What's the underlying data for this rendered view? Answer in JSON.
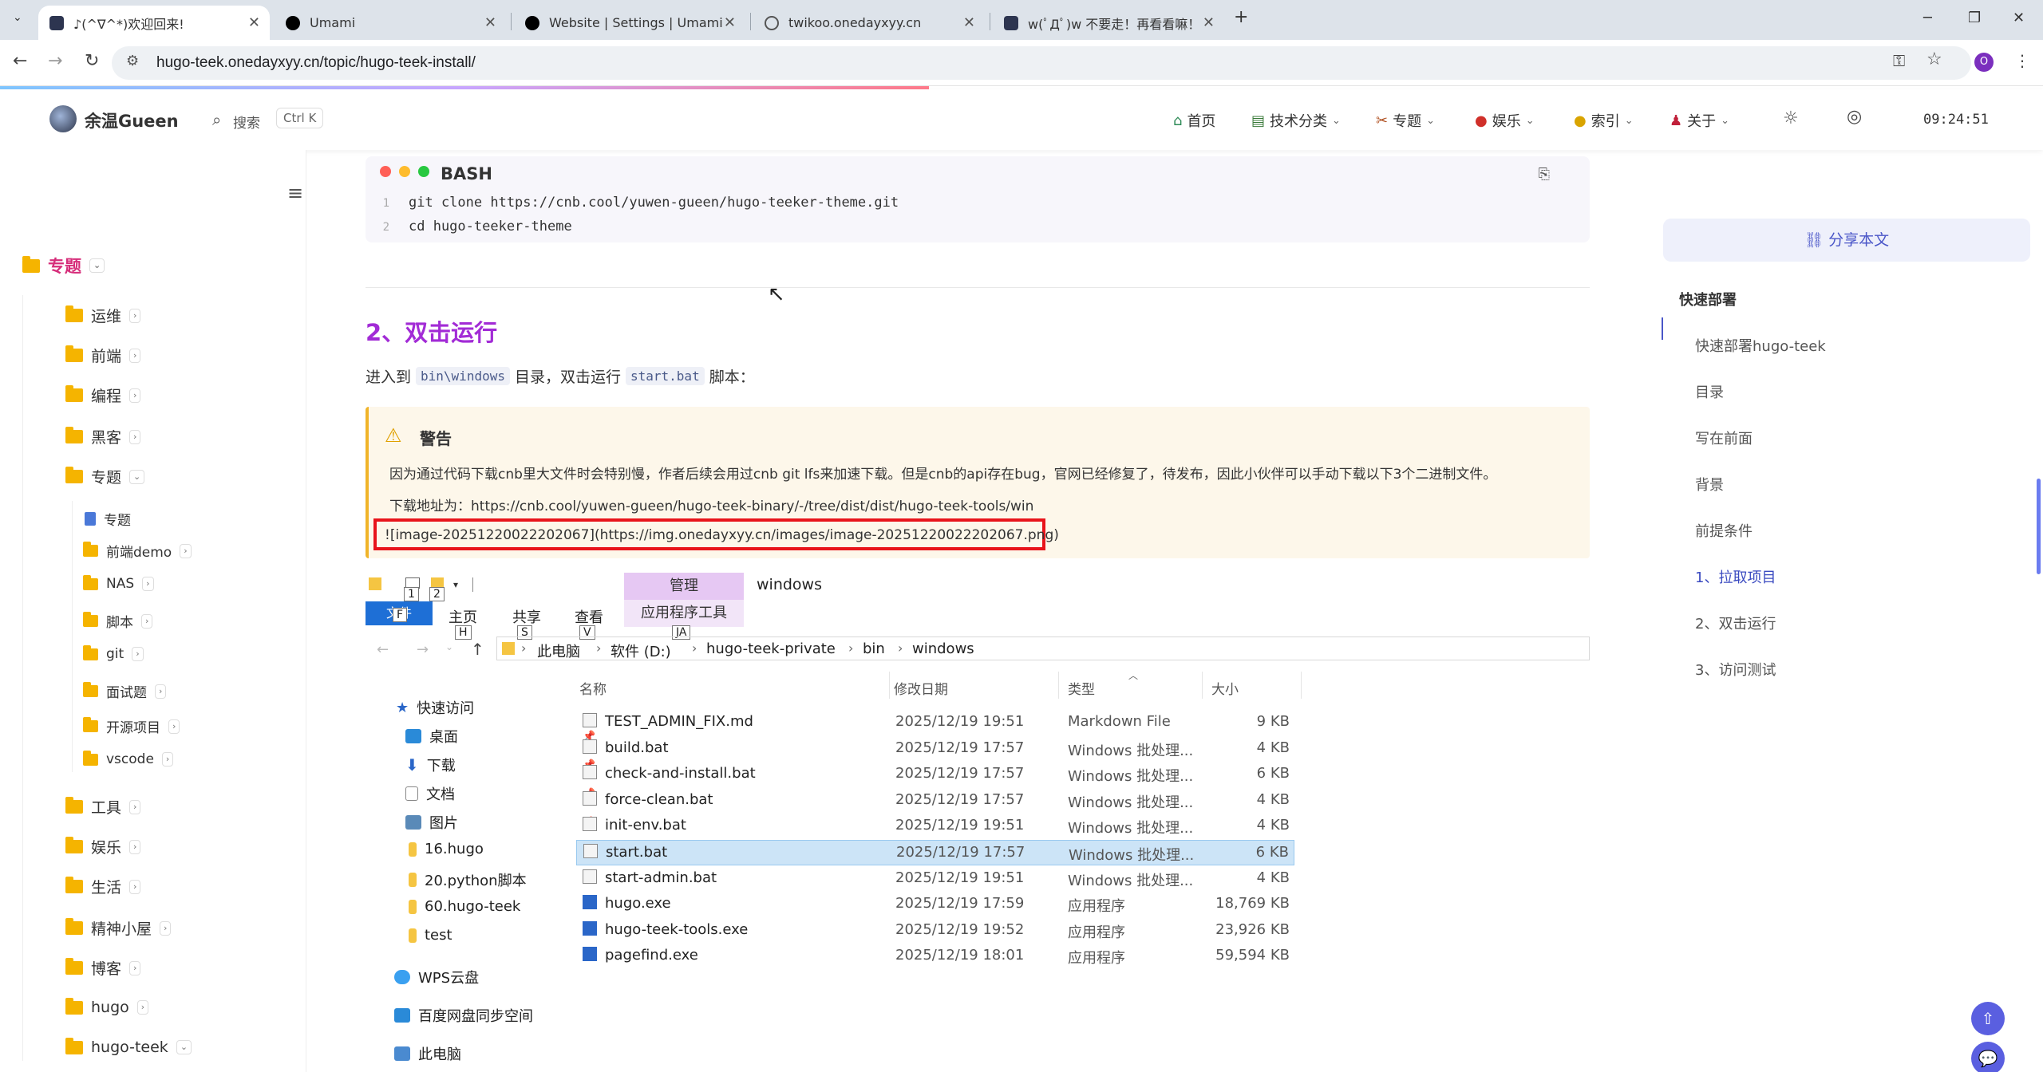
{
  "browser": {
    "tabs": [
      {
        "title": "♪(^∇^*)欢迎回来!",
        "active": true
      },
      {
        "title": "Umami"
      },
      {
        "title": "Website | Settings | Umami"
      },
      {
        "title": "twikoo.onedayxyy.cn"
      },
      {
        "title": "w(ﾟДﾟ)w 不要走！再看看嘛！"
      }
    ],
    "url": "hugo-teek.onedayxyy.cn/topic/hugo-teek-install/",
    "profile_initial": "O"
  },
  "header": {
    "site_title": "余温Gueen",
    "search_label": "搜索",
    "search_shortcut": "Ctrl K",
    "menu": [
      "首页",
      "技术分类",
      "专题",
      "娱乐",
      "索引",
      "关于"
    ],
    "clock": "09:24:51"
  },
  "sidebar": {
    "root": "专题",
    "items": [
      "运维",
      "前端",
      "编程",
      "黑客",
      "专题"
    ],
    "sub_items": [
      "专题",
      "前端demo",
      "NAS",
      "脚本",
      "git",
      "面试题",
      "开源项目",
      "vscode"
    ],
    "more_items": [
      "工具",
      "娱乐",
      "生活",
      "精神小屋",
      "博客",
      "hugo",
      "hugo-teek"
    ]
  },
  "code": {
    "lang": "BASH",
    "lines": [
      {
        "n": "1",
        "text": "git clone https://cnb.cool/yuwen-gueen/hugo-teeker-theme.git"
      },
      {
        "n": "2",
        "text": "cd hugo-teeker-theme"
      }
    ]
  },
  "section": {
    "heading": "2、双击运行",
    "para_prefix": "进入到",
    "para_code1": "bin\\windows",
    "para_mid": "目录，双击运行",
    "para_code2": "start.bat",
    "para_suffix": "脚本："
  },
  "warning": {
    "title": "警告",
    "line1": "因为通过代码下载cnb里大文件时会特别慢，作者后续会用过cnb git lfs来加速下载。但是cnb的api存在bug，官网已经修复了，待发布，因此小伙伴可以手动下载以下3个二进制文件。",
    "line2": "下载地址为：https://cnb.cool/yuwen-gueen/hugo-teek-binary/-/tree/dist/dist/hugo-teek-tools/win",
    "image_md": "![image-20251220022202067](https://img.onedayxyy.cn/images/image-20251220022202067.png)"
  },
  "explorer": {
    "ribbon": {
      "manage": "管理",
      "window_title": "windows",
      "file": "文件",
      "tabs": [
        "主页",
        "共享",
        "查看"
      ],
      "app_tools": "应用程序工具",
      "keytips": [
        "F",
        "1",
        "2",
        "H",
        "S",
        "V",
        "JA"
      ]
    },
    "breadcrumb": [
      "此电脑",
      "软件 (D:)",
      "hugo-teek-private",
      "bin",
      "windows"
    ],
    "columns": [
      "名称",
      "修改日期",
      "类型",
      "大小"
    ],
    "nav": {
      "quick_access": "快速访问",
      "pinned": [
        "桌面",
        "下载",
        "文档",
        "图片"
      ],
      "folders": [
        "16.hugo",
        "20.python脚本",
        "60.hugo-teek",
        "test"
      ],
      "wps": "WPS云盘",
      "baidu": "百度网盘同步空间",
      "pc": "此电脑"
    },
    "files": [
      {
        "name": "TEST_ADMIN_FIX.md",
        "date": "2025/12/19 19:51",
        "type": "Markdown File",
        "size": "9 KB",
        "icon": "file-icon"
      },
      {
        "name": "build.bat",
        "date": "2025/12/19 17:57",
        "type": "Windows 批处理...",
        "size": "4 KB",
        "icon": "bat-icon"
      },
      {
        "name": "check-and-install.bat",
        "date": "2025/12/19 17:57",
        "type": "Windows 批处理...",
        "size": "6 KB",
        "icon": "bat-icon"
      },
      {
        "name": "force-clean.bat",
        "date": "2025/12/19 17:57",
        "type": "Windows 批处理...",
        "size": "4 KB",
        "icon": "bat-icon"
      },
      {
        "name": "init-env.bat",
        "date": "2025/12/19 19:51",
        "type": "Windows 批处理...",
        "size": "4 KB",
        "icon": "bat-icon"
      },
      {
        "name": "start.bat",
        "date": "2025/12/19 17:57",
        "type": "Windows 批处理...",
        "size": "6 KB",
        "icon": "bat-icon"
      },
      {
        "name": "start-admin.bat",
        "date": "2025/12/19 19:51",
        "type": "Windows 批处理...",
        "size": "4 KB",
        "icon": "bat-icon"
      },
      {
        "name": "hugo.exe",
        "date": "2025/12/19 17:59",
        "type": "应用程序",
        "size": "18,769 KB",
        "icon": "exe-icon"
      },
      {
        "name": "hugo-teek-tools.exe",
        "date": "2025/12/19 19:52",
        "type": "应用程序",
        "size": "23,926 KB",
        "icon": "exe-icon"
      },
      {
        "name": "pagefind.exe",
        "date": "2025/12/19 18:01",
        "type": "应用程序",
        "size": "59,594 KB",
        "icon": "exe-icon"
      }
    ]
  },
  "toc": {
    "share": "分享本文",
    "title": "快速部署",
    "items": [
      "快速部署hugo-teek",
      "目录",
      "写在前面",
      "背景",
      "前提条件",
      "1、拉取项目",
      "2、双击运行",
      "3、访问测试"
    ]
  }
}
